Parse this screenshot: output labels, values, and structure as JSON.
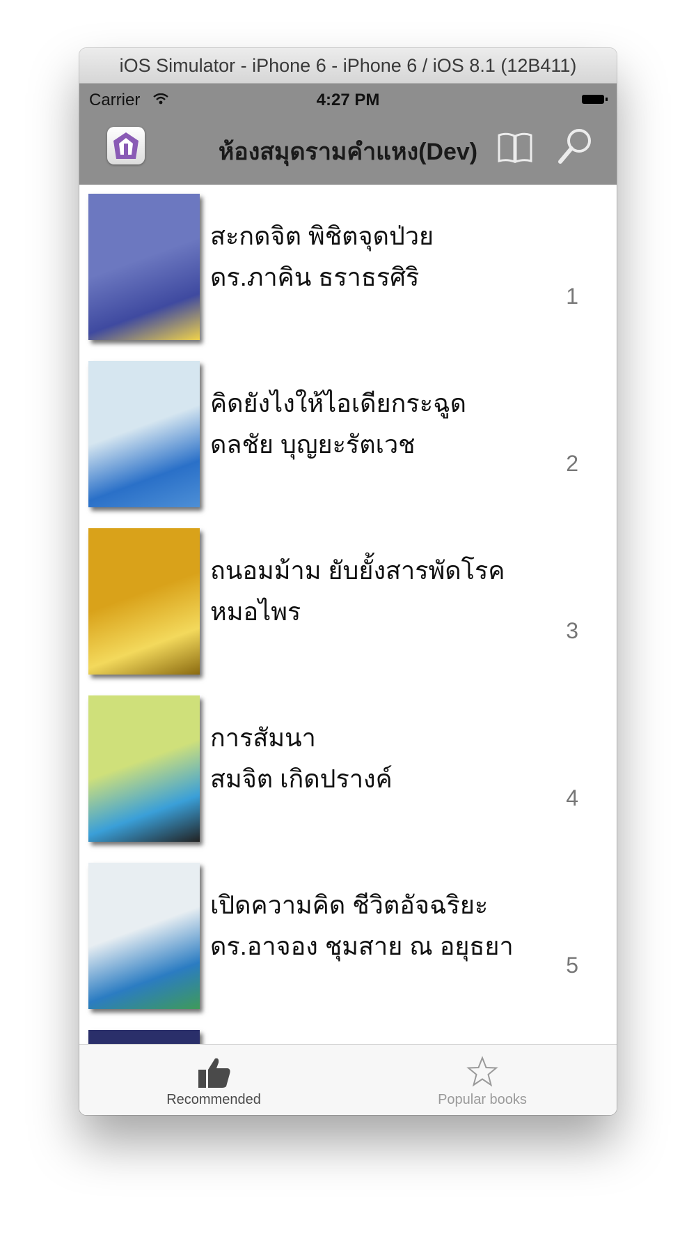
{
  "window": {
    "title": "iOS Simulator - iPhone 6 - iPhone 6 / iOS 8.1 (12B411)"
  },
  "status_bar": {
    "carrier": "Carrier",
    "time": "4:27 PM"
  },
  "navbar": {
    "title": "ห้องสมุดรามคำแหง(Dev)",
    "left_icon": "app-logo-icon",
    "right_icons": [
      "book-icon",
      "search-icon"
    ]
  },
  "books": [
    {
      "title": "สะกดจิต พิชิตจุดป่วย",
      "author": "ดร.ภาคิน ธราธรศิริ",
      "rank": "1",
      "colors": [
        "#6c78c0",
        "#3f4aa0",
        "#f0d24a"
      ]
    },
    {
      "title": "คิดยังไงให้ไอเดียกระฉูด",
      "author": "ดลชัย บุญยะรัตเวช",
      "rank": "2",
      "colors": [
        "#d6e6f0",
        "#2a70c8",
        "#4d8fd6"
      ]
    },
    {
      "title": "ถนอมม้าม ยับยั้งสารพัดโรค",
      "author": "หมอไพร",
      "rank": "3",
      "colors": [
        "#d9a21a",
        "#f3d95c",
        "#8a6a10"
      ]
    },
    {
      "title": "การสัมนา",
      "author": "สมจิต เกิดปรางค์",
      "rank": "4",
      "colors": [
        "#cfe07a",
        "#3a9fd8",
        "#222222"
      ]
    },
    {
      "title": "เปิดความคิด ชีวิตอัจฉริยะ",
      "author": "ดร.อาจอง ชุมสาย ณ อยุธยา",
      "rank": "5",
      "colors": [
        "#e8eef2",
        "#2b7cc2",
        "#3f9a5a"
      ]
    }
  ],
  "tabs": [
    {
      "label": "Recommended",
      "icon": "thumbs-up-icon",
      "selected": true
    },
    {
      "label": "Popular books",
      "icon": "star-icon",
      "selected": false
    }
  ]
}
